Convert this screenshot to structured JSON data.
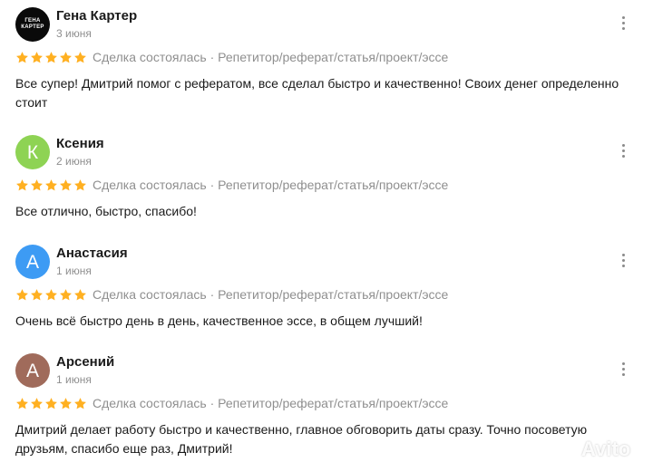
{
  "reviews": [
    {
      "name": "Гена Картер",
      "date": "3 июня",
      "avatar_letter": "",
      "avatar_logo_lines": [
        "ГЕНА",
        "КАРТЕР"
      ],
      "avatar_color": "#0a0a0a",
      "rating": 5,
      "meta": "Сделка состоялась · Репетитор/реферат/статья/проект/эссе",
      "text": "Все супер! Дмитрий помог с рефератом, все сделал быстро и качественно! Своих денег определенно стоит"
    },
    {
      "name": "Ксения",
      "date": "2 июня",
      "avatar_letter": "К",
      "avatar_color": "#8ed354",
      "rating": 5,
      "meta": "Сделка состоялась · Репетитор/реферат/статья/проект/эссе",
      "text": "Все отлично, быстро, спасибо!"
    },
    {
      "name": "Анастасия",
      "date": "1 июня",
      "avatar_letter": "А",
      "avatar_color": "#3d9bf4",
      "rating": 5,
      "meta": "Сделка состоялась · Репетитор/реферат/статья/проект/эссе",
      "text": "Очень всё быстро день в день, качественное эссе, в общем лучший!"
    },
    {
      "name": "Арсений",
      "date": "1 июня",
      "avatar_letter": "А",
      "avatar_color": "#a06b5b",
      "rating": 5,
      "meta": "Сделка состоялась · Репетитор/реферат/статья/проект/эссе",
      "text": "Дмитрий делает работу быстро и качественно, главное обговорить даты сразу. Точно посоветую друзьям, спасибо еще раз, Дмитрий!"
    }
  ],
  "colors": {
    "star": "#ffb021",
    "muted_text": "#8f8f8f",
    "menu_icon": "#8a8a8a"
  },
  "icons": {
    "menu": "more-vertical-icon",
    "star": "star-icon"
  },
  "watermark": {
    "text": "Avito"
  }
}
